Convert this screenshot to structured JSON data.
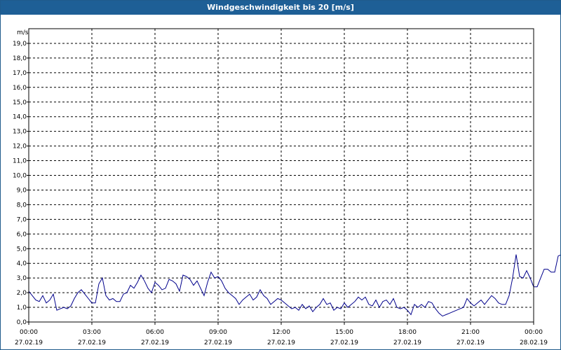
{
  "window": {
    "title": "Windgeschwindigkeit bis 20 [m/s]"
  },
  "chart_data": {
    "type": "line",
    "title": "Windgeschwindigkeit bis 20 [m/s]",
    "ylabel": "m/s",
    "xlabel": "",
    "ylim": [
      0,
      20
    ],
    "xlim": [
      "27.02.19 00:00",
      "28.02.19 00:00"
    ],
    "grid": true,
    "y_ticks": [
      "0,0",
      "1,0",
      "2,0",
      "3,0",
      "4,0",
      "5,0",
      "6,0",
      "7,0",
      "8,0",
      "9,0",
      "10,0",
      "11,0",
      "12,0",
      "13,0",
      "14,0",
      "15,0",
      "16,0",
      "17,0",
      "18,0",
      "19,0"
    ],
    "x_ticks": [
      {
        "time": "00:00",
        "date": "27.02.19"
      },
      {
        "time": "03:00",
        "date": "27.02.19"
      },
      {
        "time": "06:00",
        "date": "27.02.19"
      },
      {
        "time": "09:00",
        "date": "27.02.19"
      },
      {
        "time": "12:00",
        "date": "27.02.19"
      },
      {
        "time": "15:00",
        "date": "27.02.19"
      },
      {
        "time": "18:00",
        "date": "27.02.19"
      },
      {
        "time": "21:00",
        "date": "27.02.19"
      },
      {
        "time": "00:00",
        "date": "28.02.19"
      }
    ],
    "line_color": "#00008b",
    "series": [
      {
        "interval_minutes": 10,
        "start": "27.02.19 00:00",
        "values": [
          2.1,
          1.8,
          1.5,
          1.4,
          1.8,
          1.3,
          1.5,
          1.9,
          0.8,
          0.9,
          1.0,
          0.9,
          1.1,
          1.6,
          2.0,
          2.2,
          1.9,
          1.6,
          1.3,
          1.3,
          2.6,
          3.0,
          1.8,
          1.5,
          1.6,
          1.4,
          1.4,
          1.9,
          2.0,
          2.5,
          2.3,
          2.7,
          3.2,
          2.8,
          2.3,
          2.0,
          2.7,
          2.5,
          2.2,
          2.3,
          2.9,
          2.8,
          2.6,
          2.1,
          3.2,
          3.1,
          2.9,
          2.5,
          2.8,
          2.3,
          1.8,
          2.7,
          3.4,
          3.0,
          3.1,
          2.8,
          2.3,
          2.0,
          1.8,
          1.6,
          1.2,
          1.5,
          1.7,
          1.9,
          1.5,
          1.7,
          2.2,
          1.8,
          1.6,
          1.2,
          1.4,
          1.6,
          1.5,
          1.3,
          1.1,
          0.9,
          1.0,
          0.8,
          1.2,
          0.9,
          1.1,
          0.7,
          1.0,
          1.2,
          1.6,
          1.2,
          1.3,
          0.8,
          1.0,
          0.9,
          1.3,
          1.0,
          1.2,
          1.4,
          1.7,
          1.5,
          1.7,
          1.2,
          1.1,
          1.5,
          1.0,
          1.4,
          1.5,
          1.2,
          1.6,
          1.0,
          0.9,
          1.0,
          0.8,
          0.5,
          1.2,
          1.0,
          1.2,
          1.0,
          1.4,
          1.3,
          0.9,
          0.6,
          0.4,
          0.5,
          0.6,
          0.7,
          0.8,
          0.9,
          1.0,
          1.6,
          1.3,
          1.1,
          1.3,
          1.5,
          1.2,
          1.5,
          1.8,
          1.6,
          1.3,
          1.2,
          1.2,
          1.8,
          3.0,
          4.6,
          3.1,
          3.0,
          3.5,
          3.0,
          2.4,
          2.4,
          3.0,
          3.6,
          3.6,
          3.4,
          3.4,
          4.5,
          4.6,
          5.0,
          4.7
        ]
      }
    ]
  }
}
